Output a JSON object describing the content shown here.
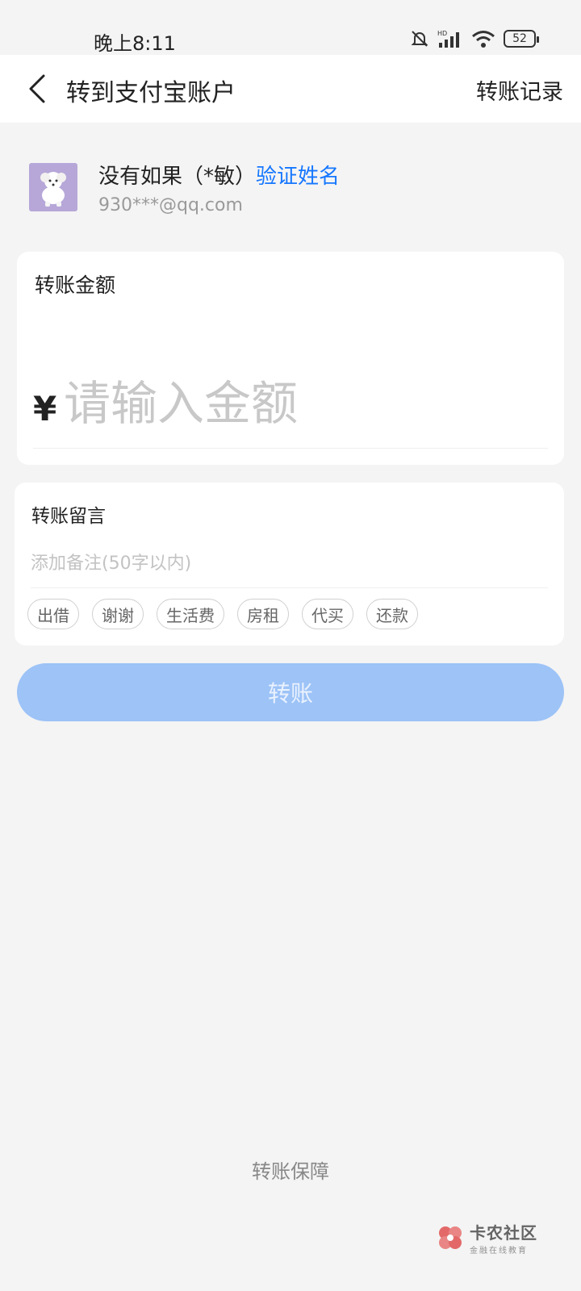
{
  "status_bar": {
    "time": "晚上8:11",
    "battery": "52",
    "icons": [
      "bell-muted-icon",
      "hd-signal-icon",
      "wifi-icon",
      "battery-icon"
    ]
  },
  "header": {
    "title": "转到支付宝账户",
    "record_link": "转账记录",
    "back_icon": "chevron-left-icon"
  },
  "recipient": {
    "name": "没有如果（*敏）",
    "verify_link": "验证姓名",
    "account": "930***@qq.com",
    "verify_color": "#1677ff"
  },
  "amount": {
    "label": "转账金额",
    "currency": "¥",
    "placeholder": "请输入金额",
    "value": ""
  },
  "remark": {
    "label": "转账留言",
    "placeholder": "添加备注(50字以内)",
    "value": "",
    "chips": [
      "出借",
      "谢谢",
      "生活费",
      "房租",
      "代买",
      "还款"
    ]
  },
  "transfer_button": {
    "label": "转账",
    "color": "#9dc3f7"
  },
  "footer": {
    "guarantee": "转账保障"
  },
  "watermark": {
    "text": "卡农社区",
    "subtext": "金融在线教育"
  }
}
